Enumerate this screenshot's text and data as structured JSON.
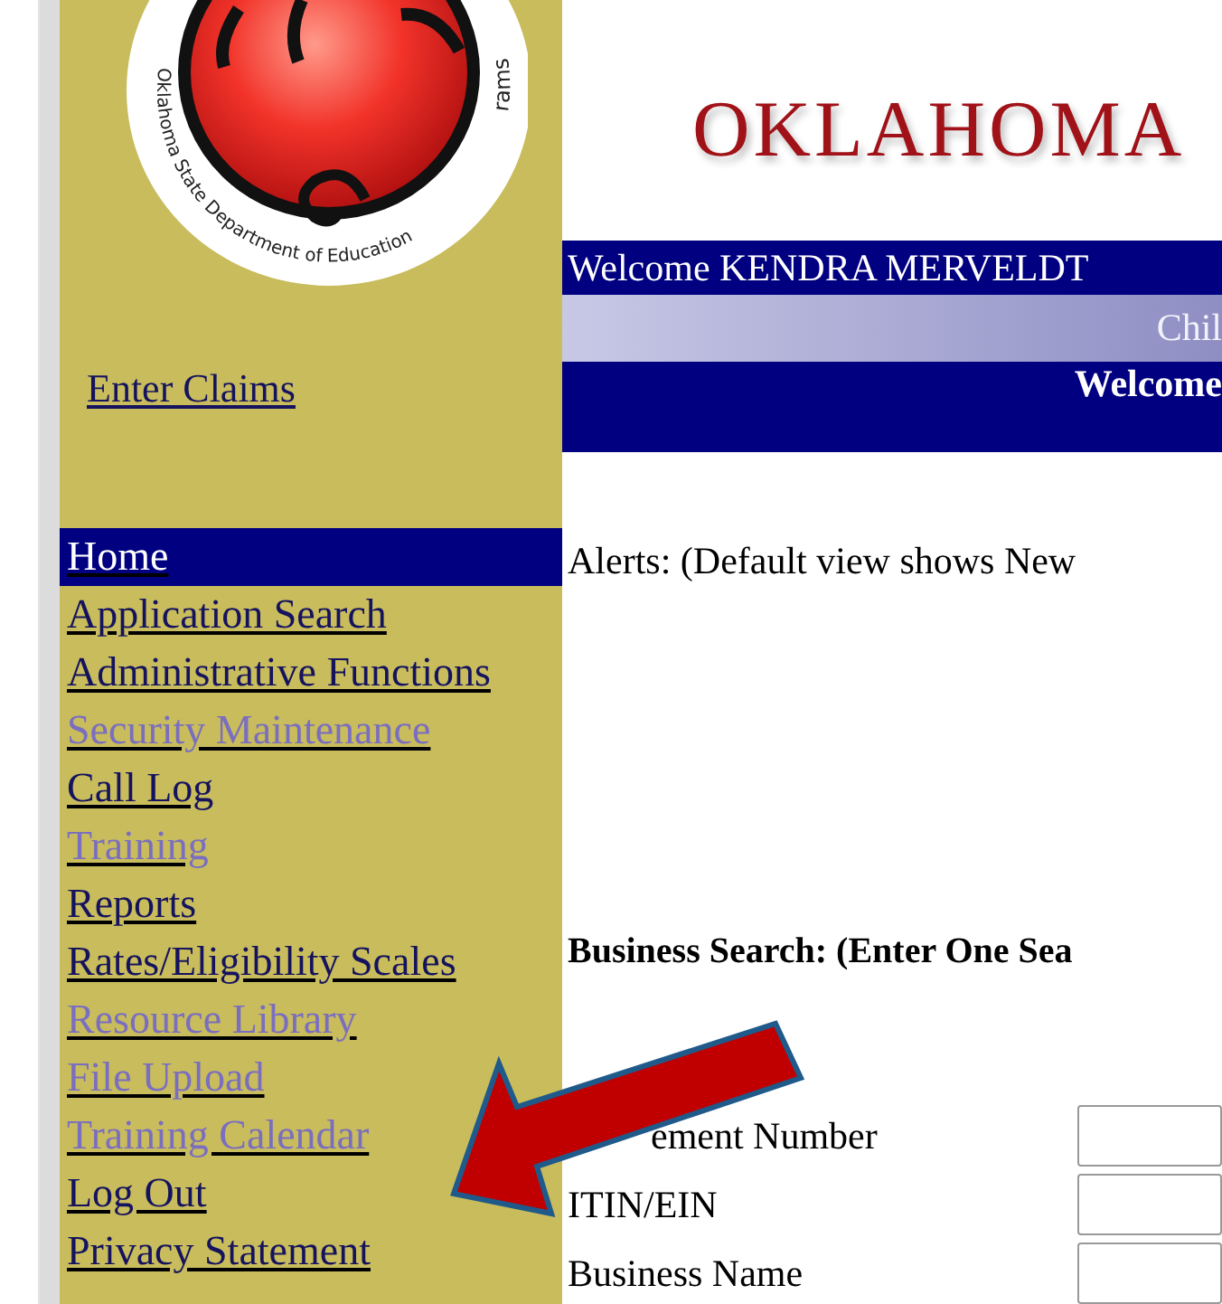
{
  "logo": {
    "ring_text": "Oklahoma State Department of Education",
    "ring_text_right": "rams"
  },
  "enter_claims": "Enter Claims",
  "menu": [
    {
      "label": "Home",
      "selected": true,
      "visited": false
    },
    {
      "label": "Application Search",
      "selected": false,
      "visited": false
    },
    {
      "label": "Administrative Functions",
      "selected": false,
      "visited": false
    },
    {
      "label": "Security Maintenance",
      "selected": false,
      "visited": true
    },
    {
      "label": "Call Log",
      "selected": false,
      "visited": false
    },
    {
      "label": "Training",
      "selected": false,
      "visited": true
    },
    {
      "label": "Reports",
      "selected": false,
      "visited": false
    },
    {
      "label": "Rates/Eligibility Scales",
      "selected": false,
      "visited": false
    },
    {
      "label": "Resource Library",
      "selected": false,
      "visited": true
    },
    {
      "label": "File Upload",
      "selected": false,
      "visited": true
    },
    {
      "label": "Training Calendar",
      "selected": false,
      "visited": true
    },
    {
      "label": "Log Out",
      "selected": false,
      "visited": false
    },
    {
      "label": "Privacy Statement",
      "selected": false,
      "visited": false
    }
  ],
  "header": {
    "title": "OKLAHOMA",
    "welcome_user": "Welcome KENDRA MERVELDT",
    "subtitle": "Chil",
    "welcome": "Welcome"
  },
  "alerts": "Alerts: (Default view shows New",
  "business_search": {
    "title": "Business Search: (Enter One Sea",
    "fields": [
      {
        "label": "ement Number"
      },
      {
        "label": "ITIN/EIN"
      },
      {
        "label": "Business Name"
      }
    ]
  }
}
